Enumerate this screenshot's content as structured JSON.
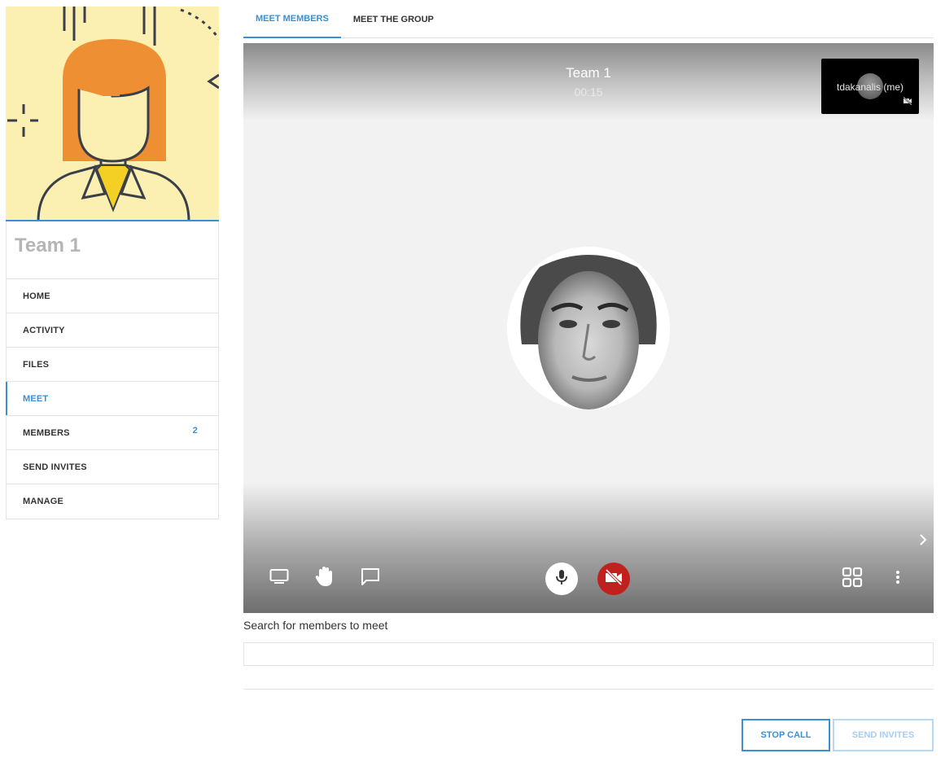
{
  "team": {
    "name": "Team 1"
  },
  "sidebar": {
    "items": [
      {
        "label": "HOME",
        "active": false
      },
      {
        "label": "ACTIVITY",
        "active": false
      },
      {
        "label": "FILES",
        "active": false
      },
      {
        "label": "MEET",
        "active": true
      },
      {
        "label": "MEMBERS",
        "active": false,
        "badge": "2"
      },
      {
        "label": "SEND INVITES",
        "active": false
      },
      {
        "label": "MANAGE",
        "active": false
      }
    ]
  },
  "tabs": [
    {
      "label": "MEET MEMBERS",
      "active": true
    },
    {
      "label": "MEET THE GROUP",
      "active": false
    }
  ],
  "call": {
    "title": "Team 1",
    "timer": "00:15",
    "self_label": "tdakanalis (me)"
  },
  "controls": {
    "left": [
      "screen-share-icon",
      "raise-hand-icon",
      "chat-icon"
    ],
    "center": [
      "microphone-icon",
      "camera-off-icon"
    ],
    "right": [
      "grid-view-icon",
      "more-options-icon"
    ]
  },
  "search": {
    "label": "Search for members to meet",
    "value": "",
    "placeholder": ""
  },
  "buttons": {
    "stop_call": "STOP CALL",
    "send_invites": "SEND INVITES"
  },
  "colors": {
    "accent": "#3a8fd6",
    "camera_off": "#c0201e",
    "cover_bg": "#fbf0b1"
  }
}
